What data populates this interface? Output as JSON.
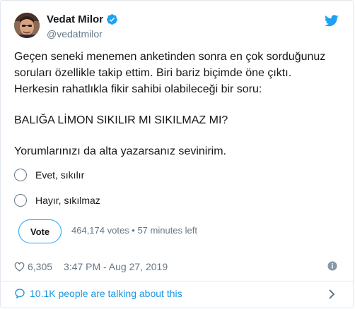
{
  "author": {
    "name": "Vedat Milor",
    "handle": "@vedatmilor"
  },
  "tweet": {
    "lines": [
      "Geçen seneki menemen anketinden sonra en çok sorduğunuz",
      "soruları özellikle takip ettim. Biri bariz biçimde öne çıktı.",
      "Herkesin rahatlıkla fikir sahibi olabileceği bir soru:",
      "BALIĞA LİMON SIKILIR MI SIKILMAZ MI?",
      "Yorumlarınızı da alta yazarsanız sevinirim."
    ]
  },
  "poll": {
    "options": [
      "Evet, sıkılır",
      "Hayır, sıkılmaz"
    ],
    "vote_label": "Vote",
    "meta": "464,174 votes • 57 minutes left"
  },
  "footer": {
    "likes": "6,305",
    "timestamp": "3:47 PM - Aug 27, 2019",
    "talking": "10.1K people are talking about this"
  },
  "colors": {
    "accent": "#1da1f2",
    "link": "#1b95e0",
    "muted": "#657786",
    "border": "#e1e8ed"
  },
  "icons": [
    "verified-badge-icon",
    "twitter-bird-icon",
    "heart-icon",
    "info-icon",
    "speech-bubble-icon",
    "chevron-right-icon"
  ]
}
